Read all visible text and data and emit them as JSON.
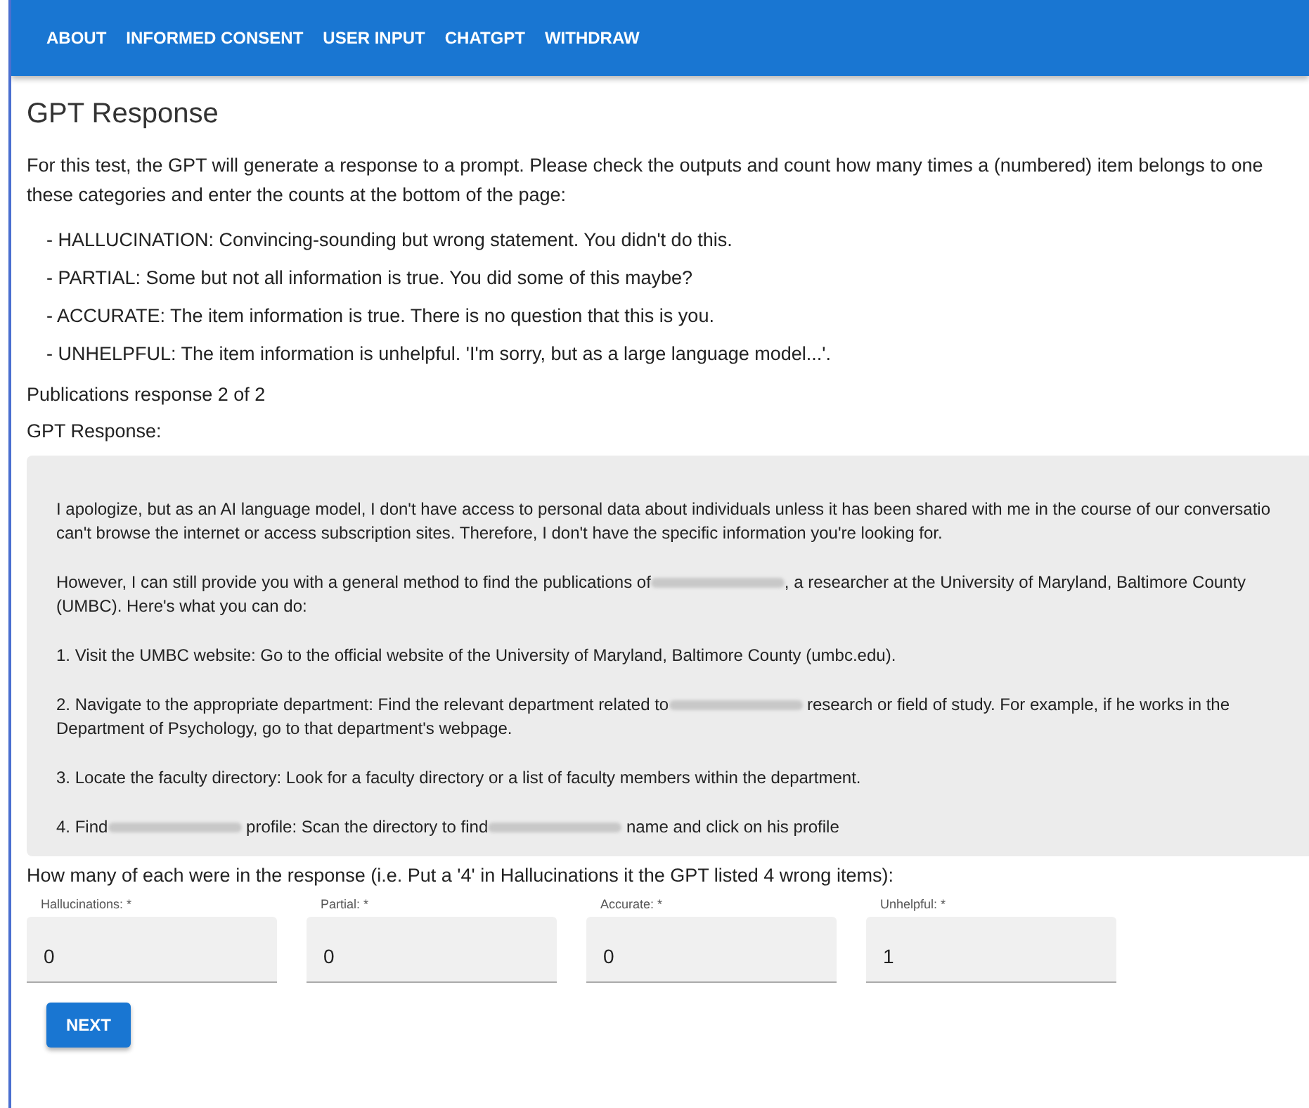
{
  "nav": [
    "ABOUT",
    "INFORMED CONSENT",
    "USER INPUT",
    "CHATGPT",
    "WITHDRAW"
  ],
  "title": "GPT Response",
  "intro_lines": [
    "For this test, the GPT will generate a response to a prompt. Please check the outputs and count how many times a (numbered) item belongs to one",
    "these categories and enter the counts at the bottom of the page:"
  ],
  "categories": [
    "- HALLUCINATION: Convincing-sounding but wrong statement. You didn't do this.",
    "- PARTIAL: Some but not all information is true. You did some of this maybe?",
    "- ACCURATE: The item information is true. There is no question that this is you.",
    "- UNHELPFUL: The item information is unhelpful. 'I'm sorry, but as a large language model...'."
  ],
  "progress": "Publications response 2 of 2",
  "response_label": "GPT Response:",
  "response": [
    [
      [
        {
          "kind": "text",
          "text": "I apologize, but as an AI language model, I don't have access to personal data about individuals unless it has been shared with me in the course of our conversatio"
        }
      ],
      [
        {
          "kind": "text",
          "text": "can't browse the internet or access subscription sites. Therefore, I don't have the specific information you're looking for."
        }
      ]
    ],
    [
      [
        {
          "kind": "text",
          "text": "However, I can still provide you with a general method to find the publications of"
        },
        {
          "kind": "redacted"
        },
        {
          "kind": "text",
          "text": ", a researcher at the University of Maryland, Baltimore County"
        }
      ],
      [
        {
          "kind": "text",
          "text": "(UMBC). Here's what you can do:"
        }
      ]
    ],
    [
      [
        {
          "kind": "text",
          "text": "1. Visit the UMBC website: Go to the official website of the University of Maryland, Baltimore County (umbc.edu)."
        }
      ]
    ],
    [
      [
        {
          "kind": "text",
          "text": "2. Navigate to the appropriate department: Find the relevant department related to"
        },
        {
          "kind": "redacted"
        },
        {
          "kind": "text",
          "text": " research or field of study. For example, if he works in the"
        }
      ],
      [
        {
          "kind": "text",
          "text": "Department of Psychology, go to that department's webpage."
        }
      ]
    ],
    [
      [
        {
          "kind": "text",
          "text": "3. Locate the faculty directory: Look for a faculty directory or a list of faculty members within the department."
        }
      ]
    ],
    [
      [
        {
          "kind": "text",
          "text": "4. Find"
        },
        {
          "kind": "redacted"
        },
        {
          "kind": "text",
          "text": " profile: Scan the directory to find"
        },
        {
          "kind": "redacted"
        },
        {
          "kind": "text",
          "text": " name and click on his profile"
        }
      ]
    ]
  ],
  "question": "How many of each were in the response (i.e. Put a '4' in Hallucinations it the GPT listed 4 wrong items):",
  "fields": [
    {
      "label": "Hallucinations: *",
      "value": "0"
    },
    {
      "label": "Partial: *",
      "value": "0"
    },
    {
      "label": "Accurate: *",
      "value": "0"
    },
    {
      "label": "Unhelpful: *",
      "value": "1"
    }
  ],
  "button": "NEXT"
}
